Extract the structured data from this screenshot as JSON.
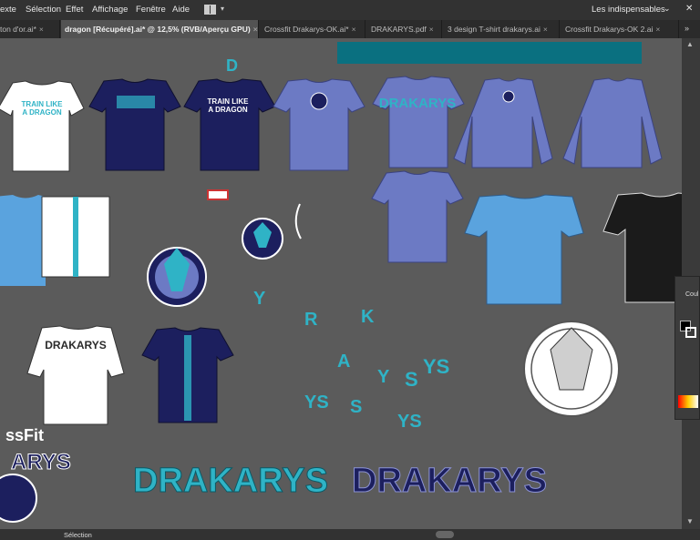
{
  "menubar": {
    "items": [
      "exte",
      "Sélection",
      "Effet",
      "Affichage",
      "Fenêtre",
      "Aide"
    ],
    "workspace": "Les indispensables"
  },
  "tabs": [
    {
      "label": "ton d'or.ai*",
      "active": false
    },
    {
      "label": "dragon [Récupéré].ai* @ 12,5% (RVB/Aperçu GPU)",
      "active": true
    },
    {
      "label": "Crossfit Drakarys-OK.ai*",
      "active": false
    },
    {
      "label": "DRAKARYS.pdf",
      "active": false
    },
    {
      "label": "3 design T-shirt drakarys.ai",
      "active": false
    },
    {
      "label": "Crossfit Drakarys-OK 2.ai",
      "active": false
    }
  ],
  "artwork": {
    "train_line1": "TRAIN LIKE",
    "train_line2": "A DRAGON",
    "drakarys": "DRAKARYS",
    "crossfit_partial": "ssFit",
    "arys_partial": "ARYS",
    "letter_d": "D",
    "letters": [
      "Y",
      "R",
      "K",
      "A",
      "Y",
      "S",
      "YS",
      "YS",
      "S",
      "YS"
    ]
  },
  "panel": {
    "title": "Coul"
  },
  "status": {
    "tool": "Sélection"
  },
  "colors": {
    "teal_bar": "#0a7080",
    "navy": "#1c1f5e",
    "periwinkle": "#6c7ac4",
    "sky": "#5aa3de",
    "teal_text": "#2fb3c6"
  }
}
